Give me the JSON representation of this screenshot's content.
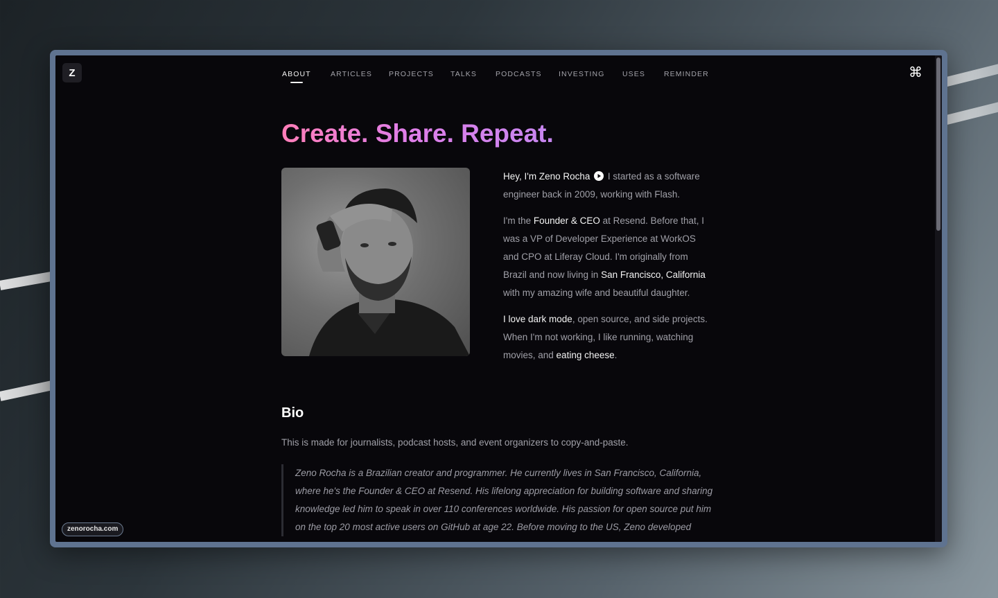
{
  "nav": {
    "logo": "Z",
    "items": [
      {
        "label": "About",
        "active": true
      },
      {
        "label": "Articles"
      },
      {
        "label": "Projects"
      },
      {
        "label": "Talks"
      },
      {
        "label": "Podcasts"
      },
      {
        "label": "Investing"
      },
      {
        "label": "Uses"
      },
      {
        "label": "Reminder"
      }
    ],
    "command_icon": "command-icon"
  },
  "hero": {
    "title": "Create. Share. Repeat.",
    "photo_icon": "portrait-photo"
  },
  "intro": {
    "p1_greeting": "Hey, I'm Zeno Rocha",
    "p1_rest": " I started as a software engineer back in 2009, working with Flash.",
    "p2_a": "I'm the ",
    "p2_role": "Founder & CEO",
    "p2_b": " at Resend. Before that, I was a VP of Developer Experience at WorkOS and CPO at Liferay Cloud. I'm originally from Brazil and now living in ",
    "p2_location": "San Francisco, California",
    "p2_c": " with my amazing wife and beautiful daughter.",
    "p3_dark": "I love dark mode",
    "p3_a": ", open source, and side projects. When I'm not working, I like running, watching movies, and ",
    "p3_cheese": "eating cheese",
    "p3_end": "."
  },
  "bio": {
    "heading": "Bio",
    "description": "This is made for journalists, podcast hosts, and event organizers to copy-and-paste.",
    "quote": "Zeno Rocha is a Brazilian creator and programmer. He currently lives in San Francisco, California, where he's the Founder & CEO at Resend. His lifelong appreciation for building software and sharing knowledge led him to speak in over 110 conferences worldwide. His passion for open source put him on the top 20 most active users on GitHub at age 22. Before moving to the US, Zeno developed"
  },
  "footer": {
    "site_badge": "zenorocha.com"
  },
  "colors": {
    "background": "#08070b",
    "title_gradient_start": "#ff7eb8",
    "title_gradient_end": "#c686f0",
    "body_text": "#a0a0a8",
    "highlight_text": "#f4f4f4"
  }
}
